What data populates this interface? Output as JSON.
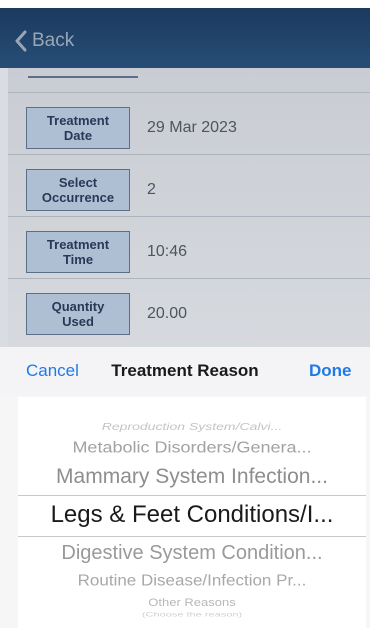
{
  "nav": {
    "back_label": "Back"
  },
  "form": {
    "rows": [
      {
        "label": "Treatment\nDate",
        "value": "29 Mar 2023"
      },
      {
        "label": "Select\nOccurrence",
        "value": "2"
      },
      {
        "label": "Treatment\nTime",
        "value": "10:46"
      },
      {
        "label": "Quantity\nUsed",
        "value": "20.00"
      }
    ]
  },
  "picker": {
    "cancel_label": "Cancel",
    "title": "Treatment Reason",
    "done_label": "Done",
    "options": [
      "Reproduction System/Calvi...",
      "Metabolic Disorders/Genera...",
      "Mammary System  Infection...",
      "Legs & Feet  Conditions/I...",
      "Digestive System Condition...",
      "Routine Disease/Infection Pr...",
      "Other Reasons",
      "(Choose the reason)"
    ],
    "selected_index": 3
  }
}
